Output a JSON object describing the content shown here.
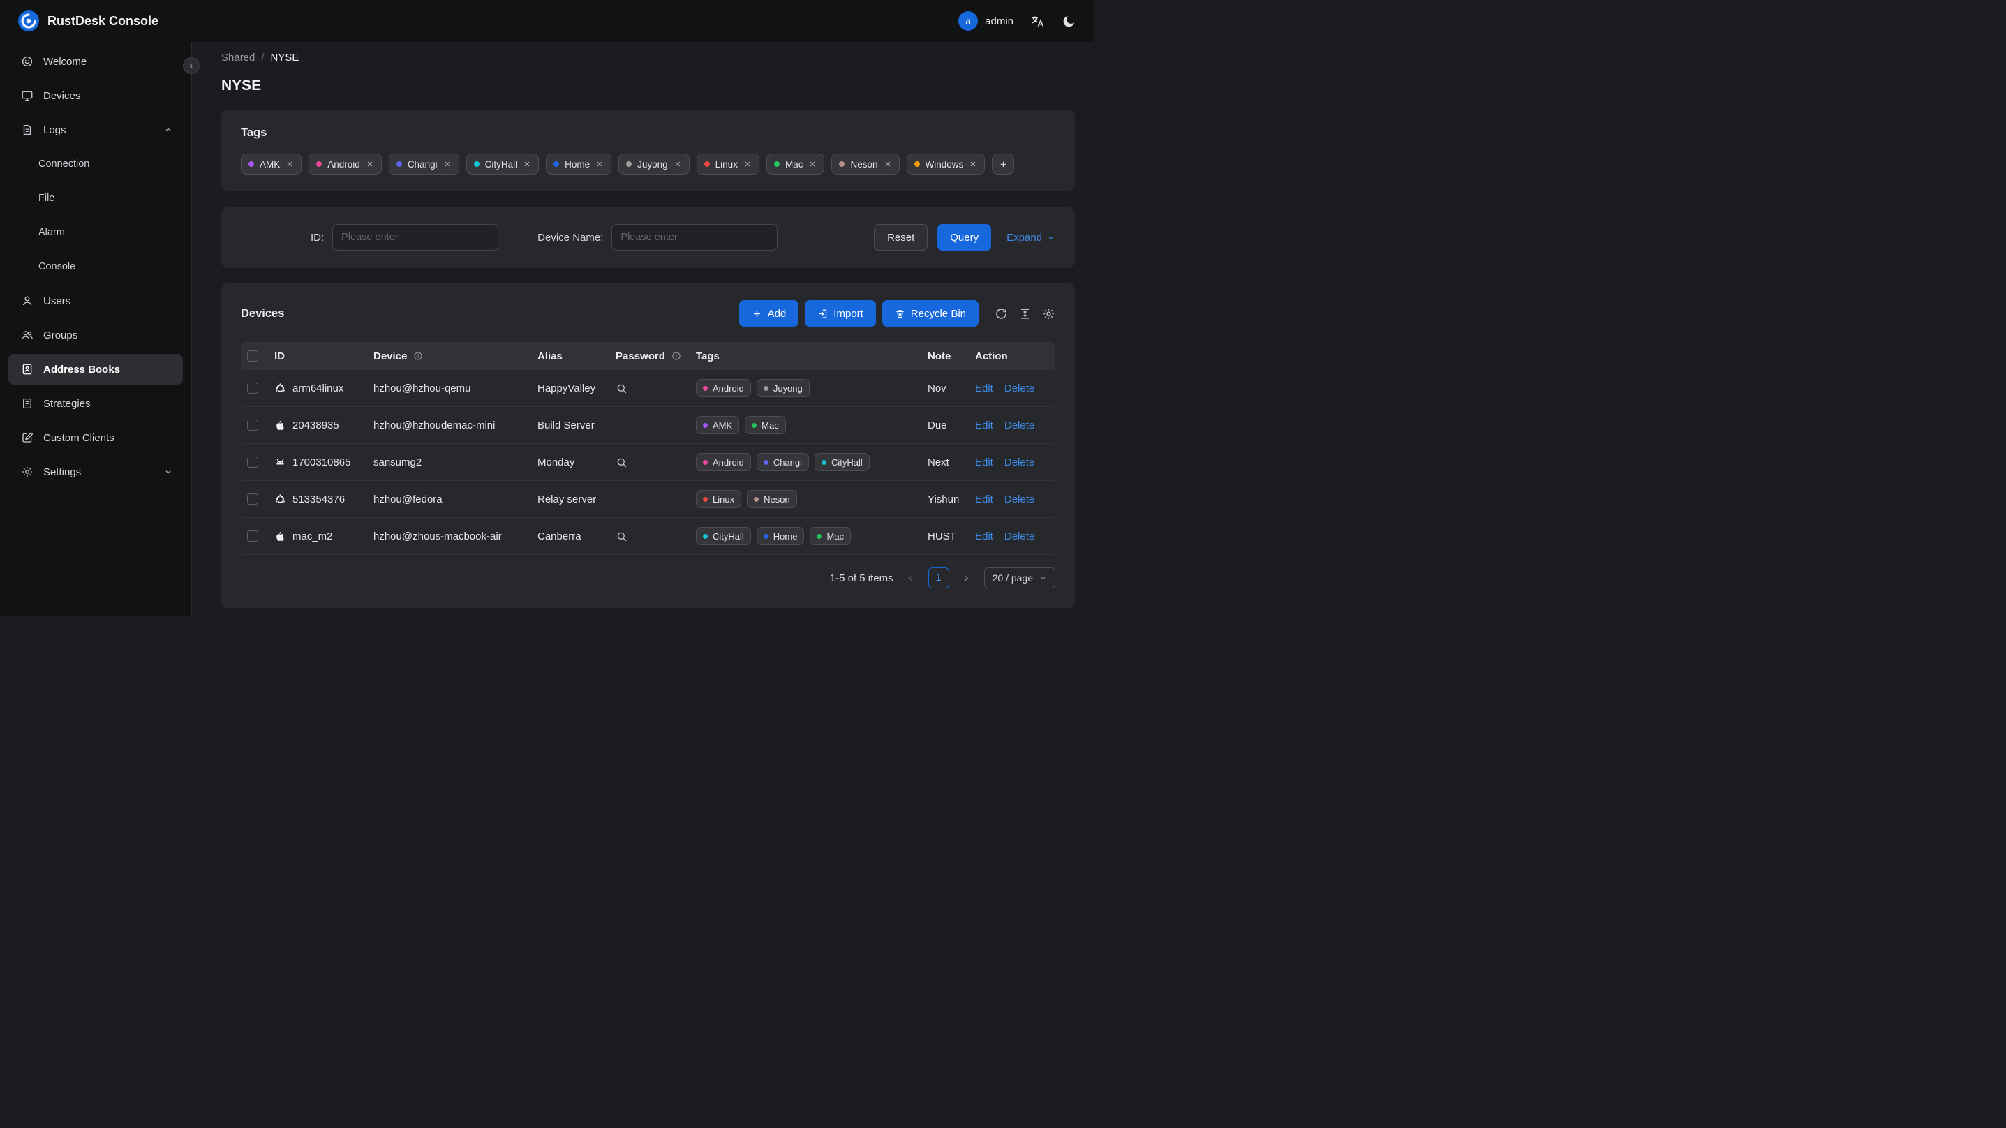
{
  "colors": {
    "accent": "#1668dc",
    "link": "#3c89e8"
  },
  "topbar": {
    "title": "RustDesk Console",
    "avatar_letter": "a",
    "username": "admin"
  },
  "icons": {
    "topbar": [
      "translate-icon",
      "moon-icon"
    ],
    "devices_toolbar": [
      "refresh-icon",
      "column-height-icon",
      "settings-icon"
    ],
    "password_reveal": "magnifier-icon"
  },
  "sidebar": {
    "welcome": "Welcome",
    "devices": "Devices",
    "logs": "Logs",
    "logs_children": {
      "connection": "Connection",
      "file": "File",
      "alarm": "Alarm",
      "console": "Console"
    },
    "users": "Users",
    "groups": "Groups",
    "address_books": "Address Books",
    "strategies": "Strategies",
    "custom_clients": "Custom Clients",
    "settings": "Settings"
  },
  "breadcrumb": {
    "parent": "Shared",
    "separator": "/",
    "current": "NYSE"
  },
  "page_title": "NYSE",
  "tags_card": {
    "title": "Tags",
    "tags": [
      {
        "label": "AMK",
        "color": "#a855f7"
      },
      {
        "label": "Android",
        "color": "#ec4899"
      },
      {
        "label": "Changi",
        "color": "#6366f1"
      },
      {
        "label": "CityHall",
        "color": "#14c4d4"
      },
      {
        "label": "Home",
        "color": "#2563eb"
      },
      {
        "label": "Juyong",
        "color": "#9e9e9e"
      },
      {
        "label": "Linux",
        "color": "#ef4444"
      },
      {
        "label": "Mac",
        "color": "#22c55e"
      },
      {
        "label": "Neson",
        "color": "#bc8f8f"
      },
      {
        "label": "Windows",
        "color": "#f59e0b"
      }
    ],
    "add_tag_label": "+"
  },
  "filter": {
    "id_label": "ID:",
    "id_placeholder": "Please enter",
    "device_label": "Device Name:",
    "device_placeholder": "Please enter",
    "reset": "Reset",
    "query": "Query",
    "expand": "Expand"
  },
  "devices": {
    "title": "Devices",
    "add": "Add",
    "import": "Import",
    "recycle_bin": "Recycle Bin",
    "headers": {
      "id": "ID",
      "device": "Device",
      "alias": "Alias",
      "password": "Password",
      "tags": "Tags",
      "note": "Note",
      "action": "Action"
    },
    "actions": {
      "edit": "Edit",
      "delete": "Delete"
    },
    "rows": [
      {
        "id": "arm64linux",
        "os": "ubuntu",
        "device": "hzhou@hzhou-qemu",
        "alias": "HappyValley",
        "has_password": true,
        "note": "Nov",
        "tags": [
          {
            "label": "Android",
            "color": "#ec4899"
          },
          {
            "label": "Juyong",
            "color": "#9e9e9e"
          }
        ]
      },
      {
        "id": "20438935",
        "os": "apple",
        "device": "hzhou@hzhoudemac-mini",
        "alias": "Build Server",
        "has_password": false,
        "note": "Due",
        "tags": [
          {
            "label": "AMK",
            "color": "#a855f7"
          },
          {
            "label": "Mac",
            "color": "#22c55e"
          }
        ]
      },
      {
        "id": "1700310865",
        "os": "android",
        "device": "sansumg2",
        "alias": "Monday",
        "has_password": true,
        "note": "Next",
        "tags": [
          {
            "label": "Android",
            "color": "#ec4899"
          },
          {
            "label": "Changi",
            "color": "#6366f1"
          },
          {
            "label": "CityHall",
            "color": "#14c4d4"
          }
        ]
      },
      {
        "id": "513354376",
        "os": "ubuntu",
        "device": "hzhou@fedora",
        "alias": "Relay server",
        "has_password": false,
        "note": "Yishun",
        "tags": [
          {
            "label": "Linux",
            "color": "#ef4444"
          },
          {
            "label": "Neson",
            "color": "#bc8f8f"
          }
        ]
      },
      {
        "id": "mac_m2",
        "os": "apple",
        "device": "hzhou@zhous-macbook-air",
        "alias": "Canberra",
        "has_password": true,
        "note": "HUST",
        "tags": [
          {
            "label": "CityHall",
            "color": "#14c4d4"
          },
          {
            "label": "Home",
            "color": "#2563eb"
          },
          {
            "label": "Mac",
            "color": "#22c55e"
          }
        ]
      }
    ],
    "pagination": {
      "summary": "1-5 of 5 items",
      "page": "1",
      "page_size": "20 / page"
    }
  }
}
